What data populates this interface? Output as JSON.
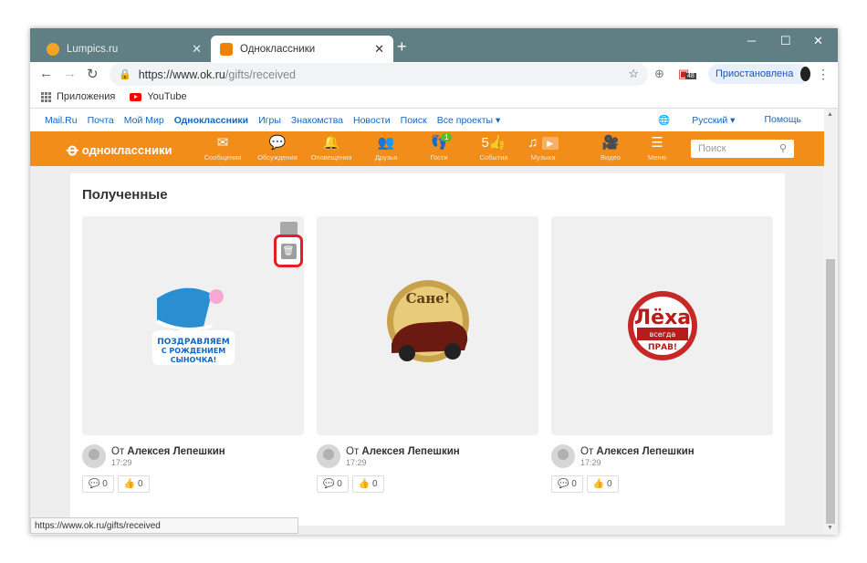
{
  "tabs": [
    {
      "title": "Lumpics.ru",
      "fav_color": "#f4a322"
    },
    {
      "title": "Одноклассники",
      "fav_color": "#ee8208"
    }
  ],
  "address": {
    "domain": "https://www.ok.ru",
    "path": "/gifts/received"
  },
  "ext_badge": "48",
  "profile": {
    "status": "Приостановлена"
  },
  "bookmarks": [
    "Приложения",
    "YouTube"
  ],
  "portal_links": [
    "Mail.Ru",
    "Почта",
    "Мой Мир",
    "Одноклассники",
    "Игры",
    "Знакомства",
    "Новости",
    "Поиск",
    "Все проекты ▾"
  ],
  "portal_right": [
    "Русский ▾",
    "Помощь"
  ],
  "ok": {
    "brand": "одноклассники",
    "nav": [
      {
        "label": "Сообщения",
        "icon": "✉"
      },
      {
        "label": "Обсуждения",
        "icon": "💬"
      },
      {
        "label": "Оповещения",
        "icon": "🔔"
      },
      {
        "label": "Друзья",
        "icon": "👥"
      },
      {
        "label": "Гости",
        "icon": "👣",
        "badge": "1"
      },
      {
        "label": "События",
        "icon": "5👍"
      },
      {
        "label": "Музыка",
        "icon": "♫"
      },
      {
        "label": "Видео",
        "icon": "🎥"
      },
      {
        "label": "Меню",
        "icon": "☰"
      }
    ],
    "search_placeholder": "Поиск"
  },
  "section_title": "Полученные",
  "gifts": [
    {
      "from_prefix": "От",
      "name": "Алексея Лепешкин",
      "time": "17:29",
      "comments": "0",
      "likes": "0",
      "art": "Поздравляем с рождением сыночка!"
    },
    {
      "from_prefix": "От",
      "name": "Алексея Лепешкин",
      "time": "17:29",
      "comments": "0",
      "likes": "0",
      "art": "Сане!"
    },
    {
      "from_prefix": "От",
      "name": "Алексея Лепешкин",
      "time": "17:29",
      "comments": "0",
      "likes": "0",
      "art": "Лёха всегда прав!"
    }
  ],
  "status_url": "https://www.ok.ru/gifts/received",
  "colors": {
    "ok_orange": "#f28d1a",
    "highlight": "#e31e24"
  }
}
